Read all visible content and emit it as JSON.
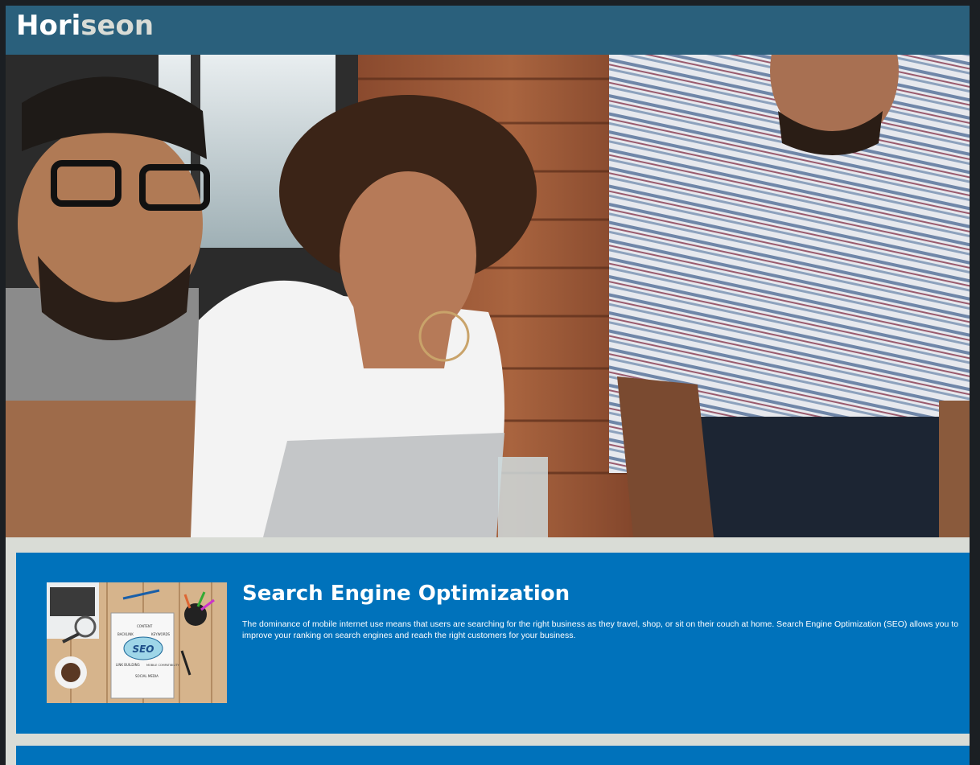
{
  "header": {
    "logo_main": "Hori",
    "logo_accent": "seon"
  },
  "hero": {
    "image_icon": "hero-photo"
  },
  "sections": [
    {
      "title": "Search Engine Optimization",
      "text": "The dominance of mobile internet use means that users are searching for the right business as they travel, shop, or sit on their couch at home. Search Engine Optimization (SEO) allows you to improve your ranking on search engines and reach the right customers for your business.",
      "thumb_badge": "SEO",
      "thumb_labels": [
        "CONTENT",
        "BACKLINK",
        "KEYWORDS",
        "LINK BUILDING",
        "MOBILE COMPATIBILITY",
        "SOCIAL MEDIA"
      ]
    }
  ],
  "colors": {
    "header_bg": "#2a607c",
    "card_bg": "#0072bb",
    "page_bg": "#d9dcd6"
  }
}
